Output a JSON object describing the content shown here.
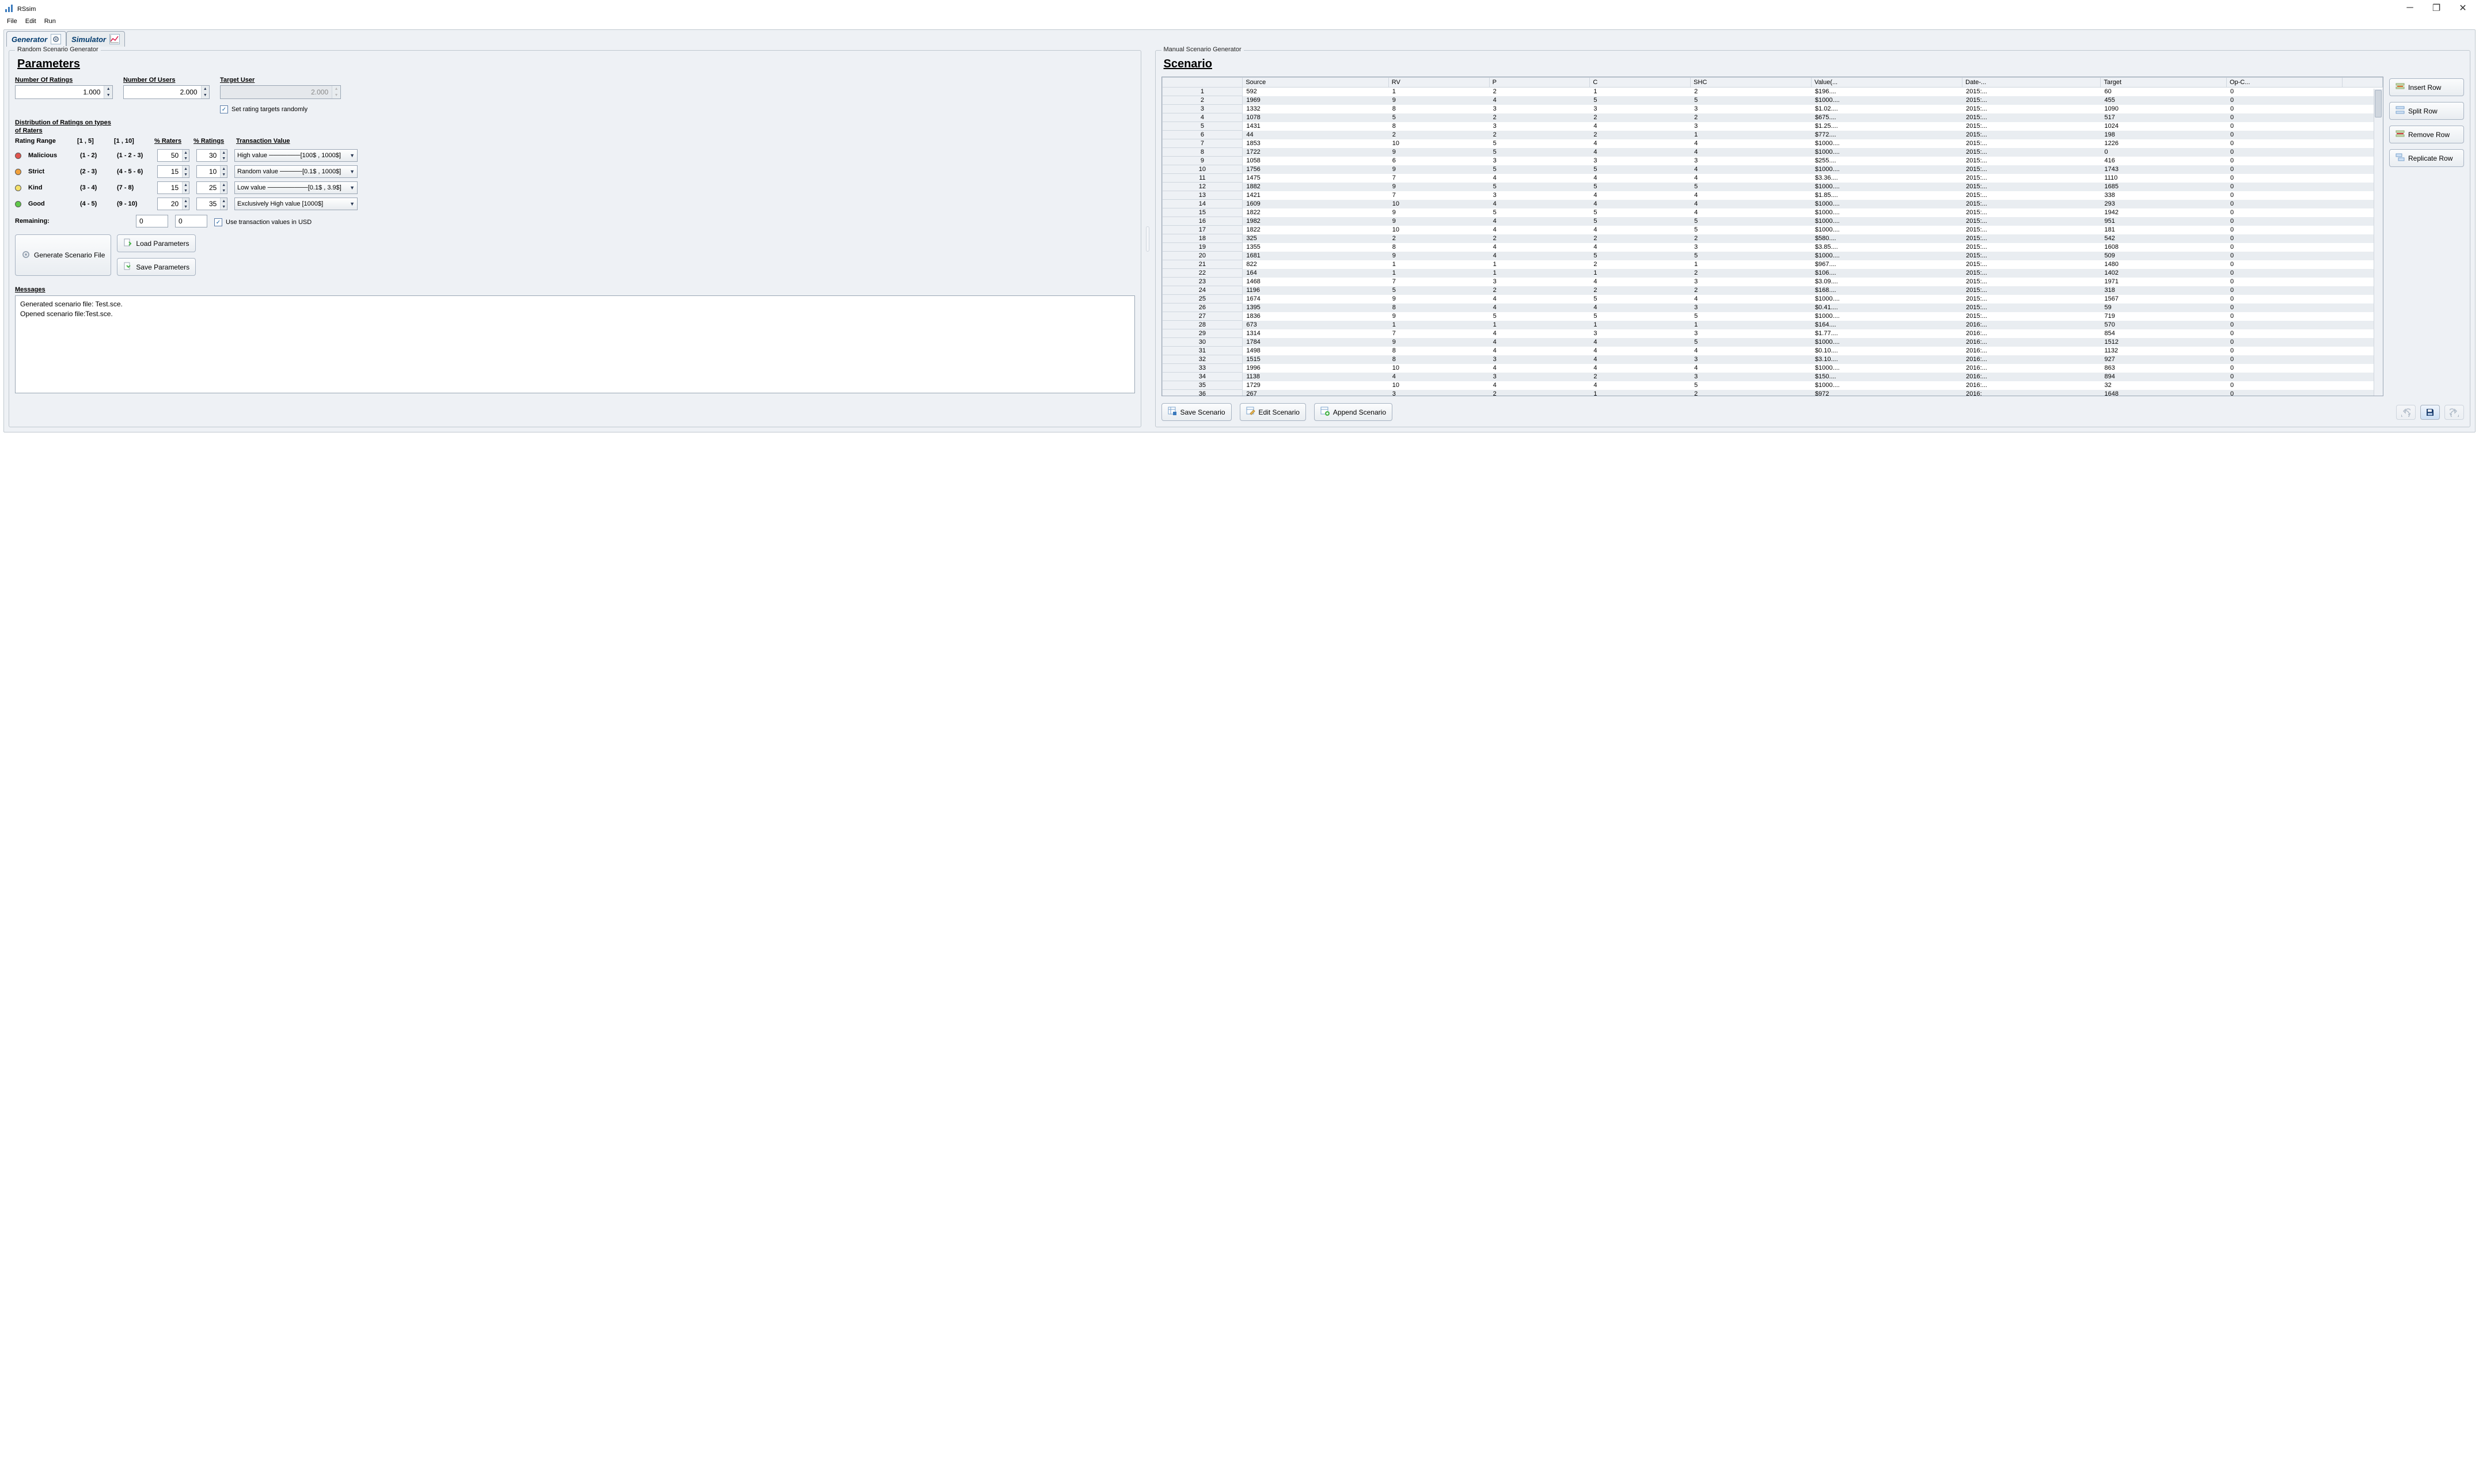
{
  "window": {
    "title": "RSsim"
  },
  "menubar": [
    "File",
    "Edit",
    "Run"
  ],
  "tabs": [
    {
      "label": "Generator",
      "active": true
    },
    {
      "label": "Simulator",
      "active": false
    }
  ],
  "left": {
    "group_title": "Random Scenario Generator",
    "parameters_heading": "Parameters",
    "num_ratings_label": "Number Of Ratings",
    "num_ratings_value": "1.000",
    "num_users_label": "Number Of Users",
    "num_users_value": "2.000",
    "target_user_label": "Target User",
    "target_user_value": "2.000",
    "set_randomly_label": "Set rating targets randomly",
    "set_randomly_checked": true,
    "dist_heading_l1": "Distribution of Ratings on types",
    "dist_heading_l2": "of Raters",
    "col_rating_range": "Rating Range",
    "col_r1": "[1 , 5]",
    "col_r2": "[1 , 10]",
    "col_pct_raters": "% Raters",
    "col_pct_ratings": "% Ratings",
    "col_trans_value": "Transaction Value",
    "raters": [
      {
        "color": "#e0554e",
        "name": "Malicious",
        "r1": "(1 - 2)",
        "r2": "(1 - 2 - 3)",
        "pct_raters": "50",
        "pct_ratings": "30",
        "trans": "High value ───────[100$ , 1000$]"
      },
      {
        "color": "#f0a03c",
        "name": "Strict",
        "r1": "(2 - 3)",
        "r2": "(4 - 5 - 6)",
        "pct_raters": "15",
        "pct_ratings": "10",
        "trans": "Random value ─────[0.1$ , 1000$]"
      },
      {
        "color": "#f4e06a",
        "name": "Kind",
        "r1": "(3 - 4)",
        "r2": "(7 - 8)",
        "pct_raters": "15",
        "pct_ratings": "25",
        "trans": "Low value ─────────[0.1$ , 3.9$]"
      },
      {
        "color": "#60c84a",
        "name": "Good",
        "r1": "(4 - 5)",
        "r2": "(9 - 10)",
        "pct_raters": "20",
        "pct_ratings": "35",
        "trans": "Exclusively High value [1000$]"
      }
    ],
    "remaining_label": "Remaining:",
    "remaining_raters": "0",
    "remaining_ratings": "0",
    "use_usd_label": "Use transaction values in USD",
    "use_usd_checked": true,
    "btn_generate": "Generate Scenario File",
    "btn_load": "Load Parameters",
    "btn_save": "Save Parameters",
    "messages_heading": "Messages",
    "messages_line1": "Generated scenario file: Test.sce.",
    "messages_line2": "Opened scenario file:Test.sce."
  },
  "right": {
    "group_title": "Manual Scenario Generator",
    "scenario_heading": "Scenario",
    "columns": [
      "",
      "Source",
      "RV",
      "P",
      "C",
      "SHC",
      "Value(...",
      "Date-...",
      "Target",
      "Op-C..."
    ],
    "btn_insert": "Insert Row",
    "btn_split": "Split Row",
    "btn_remove": "Remove Row",
    "btn_replicate": "Replicate Row",
    "btn_save_scenario": "Save Scenario",
    "btn_edit_scenario": "Edit Scenario",
    "btn_append_scenario": "Append Scenario",
    "rows": [
      {
        "idx": "1",
        "source": "592",
        "rv": "1",
        "p": "2",
        "c": "1",
        "shc": "2",
        "value": "$196....",
        "date": "2015:...",
        "target": "60",
        "opc": "0"
      },
      {
        "idx": "2",
        "source": "1969",
        "rv": "9",
        "p": "4",
        "c": "5",
        "shc": "5",
        "value": "$1000....",
        "date": "2015:...",
        "target": "455",
        "opc": "0"
      },
      {
        "idx": "3",
        "source": "1332",
        "rv": "8",
        "p": "3",
        "c": "3",
        "shc": "3",
        "value": "$1.02....",
        "date": "2015:...",
        "target": "1090",
        "opc": "0"
      },
      {
        "idx": "4",
        "source": "1078",
        "rv": "5",
        "p": "2",
        "c": "2",
        "shc": "2",
        "value": "$675....",
        "date": "2015:...",
        "target": "517",
        "opc": "0"
      },
      {
        "idx": "5",
        "source": "1431",
        "rv": "8",
        "p": "3",
        "c": "4",
        "shc": "3",
        "value": "$1.25....",
        "date": "2015:...",
        "target": "1024",
        "opc": "0"
      },
      {
        "idx": "6",
        "source": "44",
        "rv": "2",
        "p": "2",
        "c": "2",
        "shc": "1",
        "value": "$772....",
        "date": "2015:...",
        "target": "198",
        "opc": "0"
      },
      {
        "idx": "7",
        "source": "1853",
        "rv": "10",
        "p": "5",
        "c": "4",
        "shc": "4",
        "value": "$1000....",
        "date": "2015:...",
        "target": "1226",
        "opc": "0"
      },
      {
        "idx": "8",
        "source": "1722",
        "rv": "9",
        "p": "5",
        "c": "4",
        "shc": "4",
        "value": "$1000....",
        "date": "2015:...",
        "target": "0",
        "opc": "0"
      },
      {
        "idx": "9",
        "source": "1058",
        "rv": "6",
        "p": "3",
        "c": "3",
        "shc": "3",
        "value": "$255....",
        "date": "2015:...",
        "target": "416",
        "opc": "0"
      },
      {
        "idx": "10",
        "source": "1756",
        "rv": "9",
        "p": "5",
        "c": "5",
        "shc": "4",
        "value": "$1000....",
        "date": "2015:...",
        "target": "1743",
        "opc": "0"
      },
      {
        "idx": "11",
        "source": "1475",
        "rv": "7",
        "p": "4",
        "c": "4",
        "shc": "4",
        "value": "$3.36....",
        "date": "2015:...",
        "target": "1110",
        "opc": "0"
      },
      {
        "idx": "12",
        "source": "1882",
        "rv": "9",
        "p": "5",
        "c": "5",
        "shc": "5",
        "value": "$1000....",
        "date": "2015:...",
        "target": "1685",
        "opc": "0"
      },
      {
        "idx": "13",
        "source": "1421",
        "rv": "7",
        "p": "3",
        "c": "4",
        "shc": "4",
        "value": "$1.85....",
        "date": "2015:...",
        "target": "338",
        "opc": "0"
      },
      {
        "idx": "14",
        "source": "1609",
        "rv": "10",
        "p": "4",
        "c": "4",
        "shc": "4",
        "value": "$1000....",
        "date": "2015:...",
        "target": "293",
        "opc": "0"
      },
      {
        "idx": "15",
        "source": "1822",
        "rv": "9",
        "p": "5",
        "c": "5",
        "shc": "4",
        "value": "$1000....",
        "date": "2015:...",
        "target": "1942",
        "opc": "0"
      },
      {
        "idx": "16",
        "source": "1982",
        "rv": "9",
        "p": "4",
        "c": "5",
        "shc": "5",
        "value": "$1000....",
        "date": "2015:...",
        "target": "951",
        "opc": "0"
      },
      {
        "idx": "17",
        "source": "1822",
        "rv": "10",
        "p": "4",
        "c": "4",
        "shc": "5",
        "value": "$1000....",
        "date": "2015:...",
        "target": "181",
        "opc": "0"
      },
      {
        "idx": "18",
        "source": "325",
        "rv": "2",
        "p": "2",
        "c": "2",
        "shc": "2",
        "value": "$580....",
        "date": "2015:...",
        "target": "542",
        "opc": "0"
      },
      {
        "idx": "19",
        "source": "1355",
        "rv": "8",
        "p": "4",
        "c": "4",
        "shc": "3",
        "value": "$3.85....",
        "date": "2015:...",
        "target": "1608",
        "opc": "0"
      },
      {
        "idx": "20",
        "source": "1681",
        "rv": "9",
        "p": "4",
        "c": "5",
        "shc": "5",
        "value": "$1000....",
        "date": "2015:...",
        "target": "509",
        "opc": "0"
      },
      {
        "idx": "21",
        "source": "822",
        "rv": "1",
        "p": "1",
        "c": "2",
        "shc": "1",
        "value": "$967....",
        "date": "2015:...",
        "target": "1480",
        "opc": "0"
      },
      {
        "idx": "22",
        "source": "164",
        "rv": "1",
        "p": "1",
        "c": "1",
        "shc": "2",
        "value": "$106....",
        "date": "2015:...",
        "target": "1402",
        "opc": "0"
      },
      {
        "idx": "23",
        "source": "1468",
        "rv": "7",
        "p": "3",
        "c": "4",
        "shc": "3",
        "value": "$3.09....",
        "date": "2015:...",
        "target": "1971",
        "opc": "0"
      },
      {
        "idx": "24",
        "source": "1196",
        "rv": "5",
        "p": "2",
        "c": "2",
        "shc": "2",
        "value": "$168....",
        "date": "2015:...",
        "target": "318",
        "opc": "0"
      },
      {
        "idx": "25",
        "source": "1674",
        "rv": "9",
        "p": "4",
        "c": "5",
        "shc": "4",
        "value": "$1000....",
        "date": "2015:...",
        "target": "1567",
        "opc": "0"
      },
      {
        "idx": "26",
        "source": "1395",
        "rv": "8",
        "p": "4",
        "c": "4",
        "shc": "3",
        "value": "$0.41....",
        "date": "2015:...",
        "target": "59",
        "opc": "0"
      },
      {
        "idx": "27",
        "source": "1836",
        "rv": "9",
        "p": "5",
        "c": "5",
        "shc": "5",
        "value": "$1000....",
        "date": "2015:...",
        "target": "719",
        "opc": "0"
      },
      {
        "idx": "28",
        "source": "673",
        "rv": "1",
        "p": "1",
        "c": "1",
        "shc": "1",
        "value": "$164....",
        "date": "2016:...",
        "target": "570",
        "opc": "0"
      },
      {
        "idx": "29",
        "source": "1314",
        "rv": "7",
        "p": "4",
        "c": "3",
        "shc": "3",
        "value": "$1.77....",
        "date": "2016:...",
        "target": "854",
        "opc": "0"
      },
      {
        "idx": "30",
        "source": "1784",
        "rv": "9",
        "p": "4",
        "c": "4",
        "shc": "5",
        "value": "$1000....",
        "date": "2016:...",
        "target": "1512",
        "opc": "0"
      },
      {
        "idx": "31",
        "source": "1498",
        "rv": "8",
        "p": "4",
        "c": "4",
        "shc": "4",
        "value": "$0.10....",
        "date": "2016:...",
        "target": "1132",
        "opc": "0"
      },
      {
        "idx": "32",
        "source": "1515",
        "rv": "8",
        "p": "3",
        "c": "4",
        "shc": "3",
        "value": "$3.10....",
        "date": "2016:...",
        "target": "927",
        "opc": "0"
      },
      {
        "idx": "33",
        "source": "1996",
        "rv": "10",
        "p": "4",
        "c": "4",
        "shc": "4",
        "value": "$1000....",
        "date": "2016:...",
        "target": "863",
        "opc": "0"
      },
      {
        "idx": "34",
        "source": "1138",
        "rv": "4",
        "p": "3",
        "c": "2",
        "shc": "3",
        "value": "$150....",
        "date": "2016:...",
        "target": "894",
        "opc": "0"
      },
      {
        "idx": "35",
        "source": "1729",
        "rv": "10",
        "p": "4",
        "c": "4",
        "shc": "5",
        "value": "$1000....",
        "date": "2016:...",
        "target": "32",
        "opc": "0"
      },
      {
        "idx": "36",
        "source": "267",
        "rv": "3",
        "p": "2",
        "c": "1",
        "shc": "2",
        "value": "$972",
        "date": "2016:",
        "target": "1648",
        "opc": "0"
      }
    ]
  }
}
